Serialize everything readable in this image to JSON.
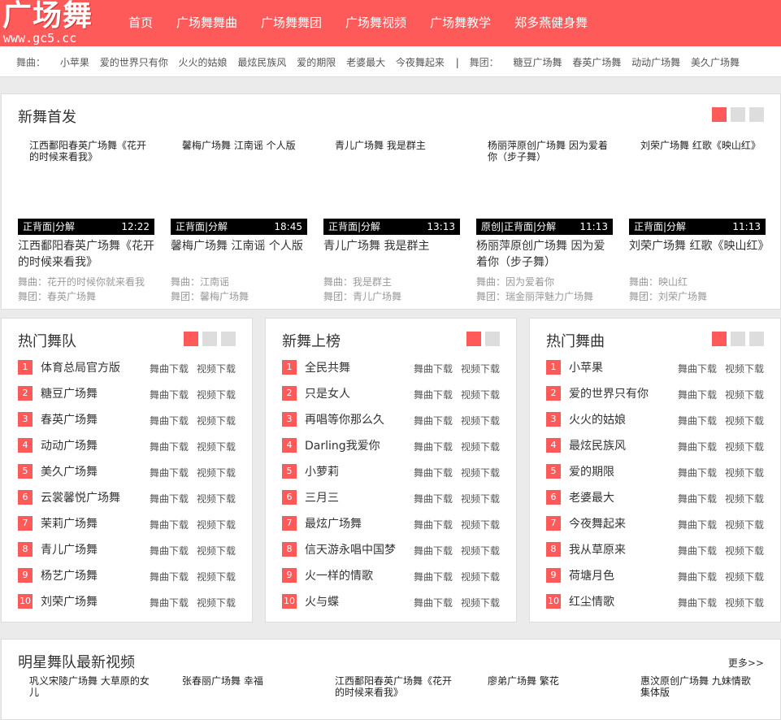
{
  "logo": {
    "title": "广场舞",
    "url": "www.gc5.cc"
  },
  "nav": [
    "首页",
    "广场舞舞曲",
    "广场舞舞团",
    "广场舞视频",
    "广场舞教学",
    "郑多燕健身舞"
  ],
  "subnav": {
    "songs_label": "舞曲：",
    "songs": [
      "小苹果",
      "爱的世界只有你",
      "火火的姑娘",
      "最炫民族风",
      "爱的期限",
      "老婆最大",
      "今夜舞起来"
    ],
    "separator": "|",
    "teams_label": "舞团：",
    "teams": [
      "糖豆广场舞",
      "春英广场舞",
      "动动广场舞",
      "美久广场舞"
    ]
  },
  "new_release": {
    "title": "新舞首发",
    "cards": [
      {
        "thumb": "江西鄱阳春英广场舞《花开的时候来看我》",
        "tag": "正背面|分解",
        "time": "12:22",
        "title": "江西鄱阳春英广场舞《花开的时候来看我》",
        "song": "舞曲：花开的时候你就来看我",
        "team": "舞团：春英广场舞"
      },
      {
        "thumb": "馨梅广场舞 江南谣 个人版",
        "tag": "正背面|分解",
        "time": "18:45",
        "title": "馨梅广场舞 江南谣 个人版",
        "song": "舞曲：江南谣",
        "team": "舞团：馨梅广场舞"
      },
      {
        "thumb": "青儿广场舞 我是群主",
        "tag": "正背面|分解",
        "time": "13:13",
        "title": "青儿广场舞 我是群主",
        "song": "舞曲：我是群主",
        "team": "舞团：青儿广场舞"
      },
      {
        "thumb": "杨丽萍原创广场舞 因为爱着你（步子舞）",
        "tag": "原创|正背面|分解",
        "time": "11:13",
        "title": "杨丽萍原创广场舞 因为爱着你（步子舞）",
        "song": "舞曲：因为爱着你",
        "team": "舞团：瑞金丽萍魅力广场舞"
      },
      {
        "thumb": "刘荣广场舞 红歌《映山红》",
        "tag": "正背面|分解",
        "time": "11:13",
        "title": "刘荣广场舞 红歌《映山红》",
        "song": "舞曲：映山红",
        "team": "舞团：刘荣广场舞"
      }
    ]
  },
  "download": {
    "song": "舞曲下载",
    "video": "视频下载"
  },
  "hot_teams": {
    "title": "热门舞队",
    "items": [
      "体育总局官方版",
      "糖豆广场舞",
      "春英广场舞",
      "动动广场舞",
      "美久广场舞",
      "云裳馨悦广场舞",
      "茉莉广场舞",
      "青儿广场舞",
      "杨艺广场舞",
      "刘荣广场舞"
    ]
  },
  "new_chart": {
    "title": "新舞上榜",
    "items": [
      "全民共舞",
      "只是女人",
      "再唱等你那么久",
      "Darling我爱你",
      "小萝莉",
      "三月三",
      "最炫广场舞",
      "信天游永唱中国梦",
      "火一样的情歌",
      "火与蝶"
    ]
  },
  "hot_songs": {
    "title": "热门舞曲",
    "items": [
      "小苹果",
      "爱的世界只有你",
      "火火的姑娘",
      "最炫民族风",
      "爱的期限",
      "老婆最大",
      "今夜舞起来",
      "我从草原来",
      "荷塘月色",
      "红尘情歌"
    ]
  },
  "star_videos": {
    "title": "明星舞队最新视频",
    "more": "更多>>",
    "items": [
      "巩义宋陵广场舞 大草原的女儿",
      "张春丽广场舞 幸福",
      "江西鄱阳春英广场舞《花开的时候来看我》",
      "廖弟广场舞 繁花",
      "惠汶原创广场舞 九妹情歌 集体版"
    ]
  },
  "colors": {
    "accent": "#ff5a5a",
    "inactive": "#dddddd",
    "background": "#ebebeb"
  }
}
